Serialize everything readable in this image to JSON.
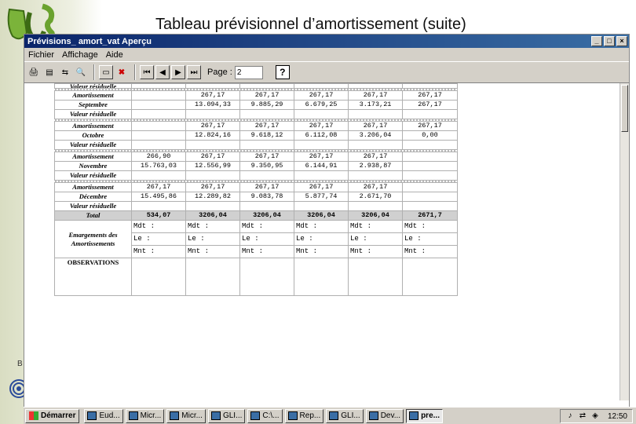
{
  "slide": {
    "title": "Tableau  prévisionnel d’amortissement (suite)",
    "footer_mark": "B"
  },
  "window": {
    "title": "Prévisions_ amort_vat  Aperçu",
    "controls": [
      "_",
      "□",
      "×"
    ]
  },
  "menu": {
    "items": [
      "Fichier",
      "Affichage",
      "Aide"
    ]
  },
  "toolbar": {
    "page_label": "Page :",
    "page_value": "2",
    "help": "?"
  },
  "table": {
    "rows": [
      {
        "label": "Valeur résiduelle",
        "cells": [
          "",
          "",
          "",
          "",
          "",
          ""
        ],
        "partial": true
      },
      {
        "label": "Amortissement",
        "cells": [
          "",
          "267,17",
          "267,17",
          "267,17",
          "267,17",
          "267,17"
        ]
      },
      {
        "label": "Septembre",
        "cells": [
          "",
          "13.094,33",
          "9.885,29",
          "6.679,25",
          "3.173,21",
          "267,17"
        ]
      },
      {
        "label": "Valeur résiduelle",
        "cells": [
          "",
          "",
          "",
          "",
          "",
          ""
        ]
      },
      {
        "label": "Amortissement",
        "cells": [
          "",
          "267,17",
          "267,17",
          "267,17",
          "267,17",
          "267,17"
        ]
      },
      {
        "label": "Octobre",
        "cells": [
          "",
          "12.824,16",
          "9.618,12",
          "6.112,08",
          "3.206,04",
          "0,00"
        ]
      },
      {
        "label": "Valeur résiduelle",
        "cells": [
          "",
          "",
          "",
          "",
          "",
          ""
        ]
      },
      {
        "label": "Amortissement",
        "cells": [
          "266,90",
          "267,17",
          "267,17",
          "267,17",
          "267,17",
          ""
        ]
      },
      {
        "label": "Novembre",
        "cells": [
          "15.763,03",
          "12.556,99",
          "9.350,95",
          "6.144,91",
          "2.938,87",
          ""
        ]
      },
      {
        "label": "Valeur résiduelle",
        "cells": [
          "",
          "",
          "",
          "",
          "",
          ""
        ]
      },
      {
        "label": "Amortissement",
        "cells": [
          "267,17",
          "267,17",
          "267,17",
          "267,17",
          "267,17",
          ""
        ]
      },
      {
        "label": "Décembre",
        "cells": [
          "15.495,86",
          "12.289,82",
          "9.083,78",
          "5.877,74",
          "2.671,70",
          ""
        ]
      },
      {
        "label": "Valeur résiduelle",
        "cells": [
          "",
          "",
          "",
          "",
          "",
          ""
        ]
      }
    ],
    "total": {
      "label": "Total",
      "cells": [
        "534,07",
        "3206,04",
        "3206,04",
        "3206,04",
        "3206,04",
        "2671,7"
      ]
    },
    "emargement": {
      "label": "Emargements des Amortissements",
      "lines": [
        "Mdt :",
        "Le :",
        "Mnt :"
      ]
    },
    "observations": {
      "label": "OBSERVATIONS"
    }
  },
  "taskbar": {
    "start": "Démarrer",
    "tasks": [
      "Eud...",
      "Micr...",
      "Micr...",
      "GLI...",
      "C:\\...",
      "Rep...",
      "GLI...",
      "Dev...",
      "pre..."
    ],
    "active_index": 8,
    "clock": "12:50"
  },
  "colors": {
    "titlebar": "#0a246a",
    "chrome": "#d4d0c8",
    "total_row": "#d0d0d0"
  }
}
